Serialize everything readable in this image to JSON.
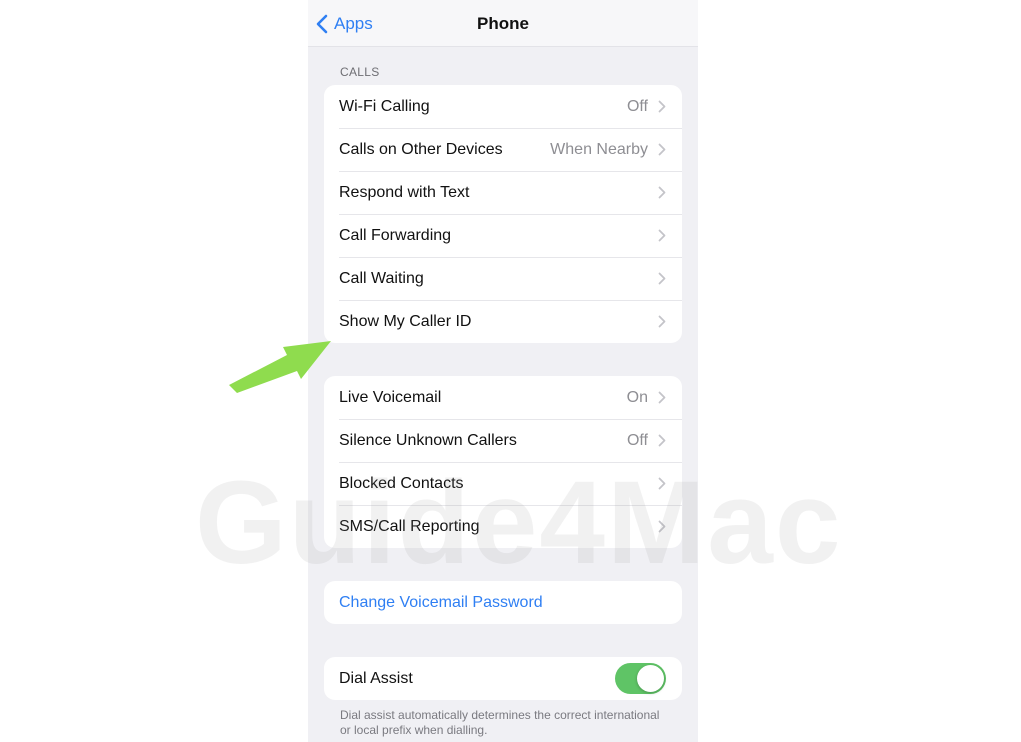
{
  "nav": {
    "back_label": "Apps",
    "title": "Phone",
    "back_icon": "chevron-left-icon"
  },
  "calls_section": {
    "header": "CALLS",
    "rows": [
      {
        "label": "Wi-Fi Calling",
        "value": "Off"
      },
      {
        "label": "Calls on Other Devices",
        "value": "When Nearby"
      },
      {
        "label": "Respond with Text",
        "value": ""
      },
      {
        "label": "Call Forwarding",
        "value": ""
      },
      {
        "label": "Call Waiting",
        "value": ""
      },
      {
        "label": "Show My Caller ID",
        "value": ""
      }
    ]
  },
  "voicemail_section": {
    "rows": [
      {
        "label": "Live Voicemail",
        "value": "On"
      },
      {
        "label": "Silence Unknown Callers",
        "value": "Off"
      },
      {
        "label": "Blocked Contacts",
        "value": ""
      },
      {
        "label": "SMS/Call Reporting",
        "value": ""
      }
    ]
  },
  "password_section": {
    "label": "Change Voicemail Password"
  },
  "dial_assist": {
    "label": "Dial Assist",
    "enabled": true,
    "footer": "Dial assist automatically determines the correct international or local prefix when dialling."
  },
  "annotation": {
    "arrow_color": "#8fdc4e",
    "arrow_target": "Show My Caller ID"
  },
  "watermark": {
    "text": "Guide4Mac"
  },
  "colors": {
    "accent": "#2f7ff3",
    "toggle_on": "#5fc466",
    "background": "#f0f0f4"
  }
}
